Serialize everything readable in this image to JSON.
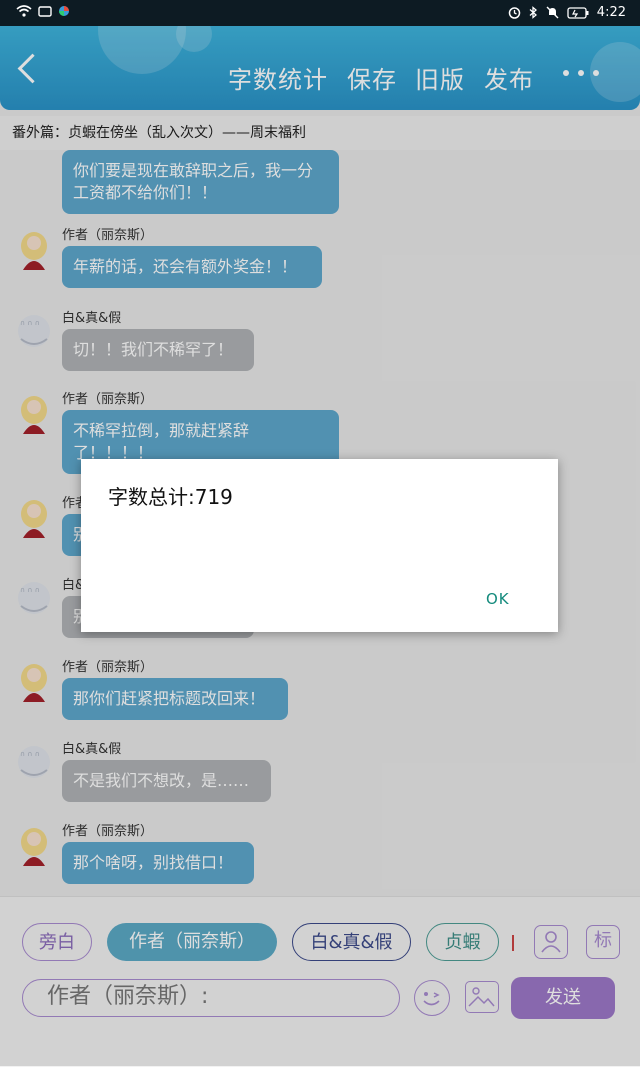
{
  "status_bar": {
    "time": "4:22",
    "left_icons": [
      "wifi-icon",
      "folder-icon",
      "app-icon"
    ],
    "right_icons": [
      "alarm-icon",
      "bluetooth-icon",
      "mute-icon",
      "battery-icon"
    ]
  },
  "header": {
    "back_icon": "back-arrow-icon",
    "buttons": [
      "字数统计",
      "保存",
      "旧版",
      "发布"
    ],
    "more_icon": "more-icon"
  },
  "chapter_title": "番外篇：贞蝦在傍坐（乱入次文）——周末福利",
  "messages": [
    {
      "sender": "",
      "text_lines": [
        "你们要是现在敢辞职之后，我一分",
        "工资都不给你们！！"
      ],
      "style": "blue"
    },
    {
      "sender": "作者（丽奈斯）",
      "text_lines": [
        "年薪的话，还会有额外奖金！！"
      ],
      "style": "blue"
    },
    {
      "sender": "白&真&假",
      "text_lines": [
        "切！！我们不稀罕了！"
      ],
      "style": "grey"
    },
    {
      "sender": "作者（丽奈斯）",
      "text_lines": [
        "不稀罕拉倒，那就赶紧辞",
        "了！！！！"
      ],
      "style": "blue"
    },
    {
      "sender": "作者",
      "text_lines": [
        "别"
      ],
      "style": "blue"
    },
    {
      "sender": "白&",
      "text_lines": [
        "别"
      ],
      "style": "grey"
    },
    {
      "sender": "作者（丽奈斯）",
      "text_lines": [
        "那你们赶紧把标题改回来！"
      ],
      "style": "blue"
    },
    {
      "sender": "白&真&假",
      "text_lines": [
        "不是我们不想改，是……"
      ],
      "style": "grey"
    },
    {
      "sender": "作者（丽奈斯）",
      "text_lines": [
        "那个啥呀，别找借口！"
      ],
      "style": "blue"
    }
  ],
  "role_chips": [
    "旁白",
    "作者（丽奈斯）",
    "白&真&假",
    "贞蝦"
  ],
  "side_icons": {
    "portrait": "portrait-icon",
    "mark_label": "标"
  },
  "input": {
    "value": "作者（丽奈斯）:"
  },
  "send_label": "发送",
  "dialog": {
    "message": "字数总计:719",
    "ok_label": "OK"
  }
}
